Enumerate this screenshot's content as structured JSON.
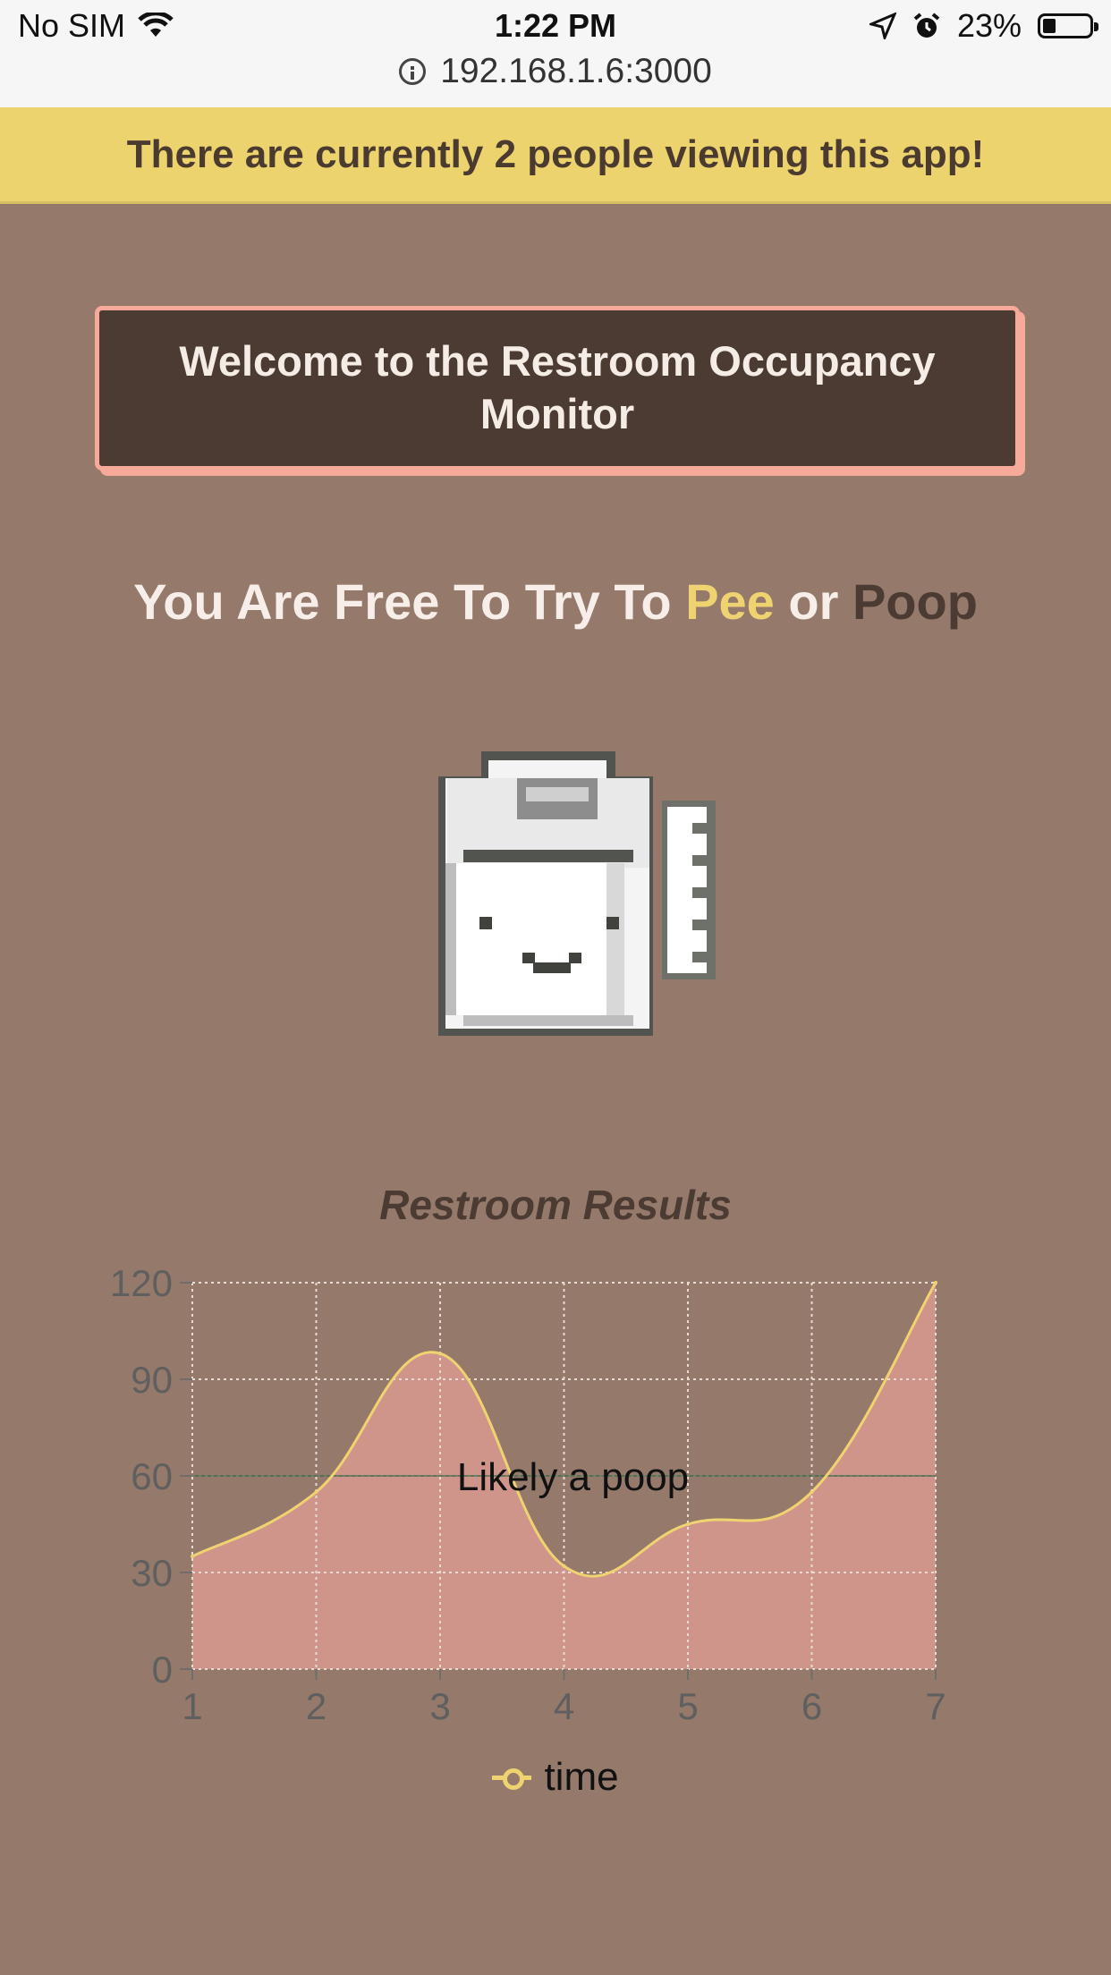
{
  "status_bar": {
    "carrier": "No SIM",
    "time": "1:22 PM",
    "battery": "23%",
    "icons": [
      "wifi-icon",
      "location-icon",
      "alarm-icon",
      "battery-icon"
    ]
  },
  "browser": {
    "url": "192.168.1.6:3000"
  },
  "banner": {
    "text": "There are currently 2 people viewing this app!"
  },
  "welcome": {
    "text": "Welcome to the Restroom Occupancy Monitor"
  },
  "headline": {
    "prefix": "You Are Free To Try To ",
    "pee": "Pee",
    "or": " or ",
    "poop": "Poop"
  },
  "mascot": {
    "icon": "toilet-paper-icon"
  },
  "colors": {
    "background": "#95796b",
    "banner": "#edd36d",
    "accent_pink": "#f7a99a",
    "dark_brown": "#4b3b32",
    "line_yellow": "#efd370",
    "area_fill": "#cf958a"
  },
  "chart_data": {
    "type": "area",
    "title": "Restroom Results",
    "x": [
      1,
      2,
      3,
      4,
      5,
      6,
      7
    ],
    "series": [
      {
        "name": "time",
        "values": [
          35,
          55,
          98,
          32,
          45,
          55,
          120
        ]
      }
    ],
    "ylim": [
      0,
      120
    ],
    "yticks": [
      0,
      30,
      60,
      90,
      120
    ],
    "xticks": [
      1,
      2,
      3,
      4,
      5,
      6,
      7
    ],
    "grid": true,
    "legend": "bottom",
    "annotation": {
      "y": 60,
      "label": "Likely a poop"
    }
  }
}
